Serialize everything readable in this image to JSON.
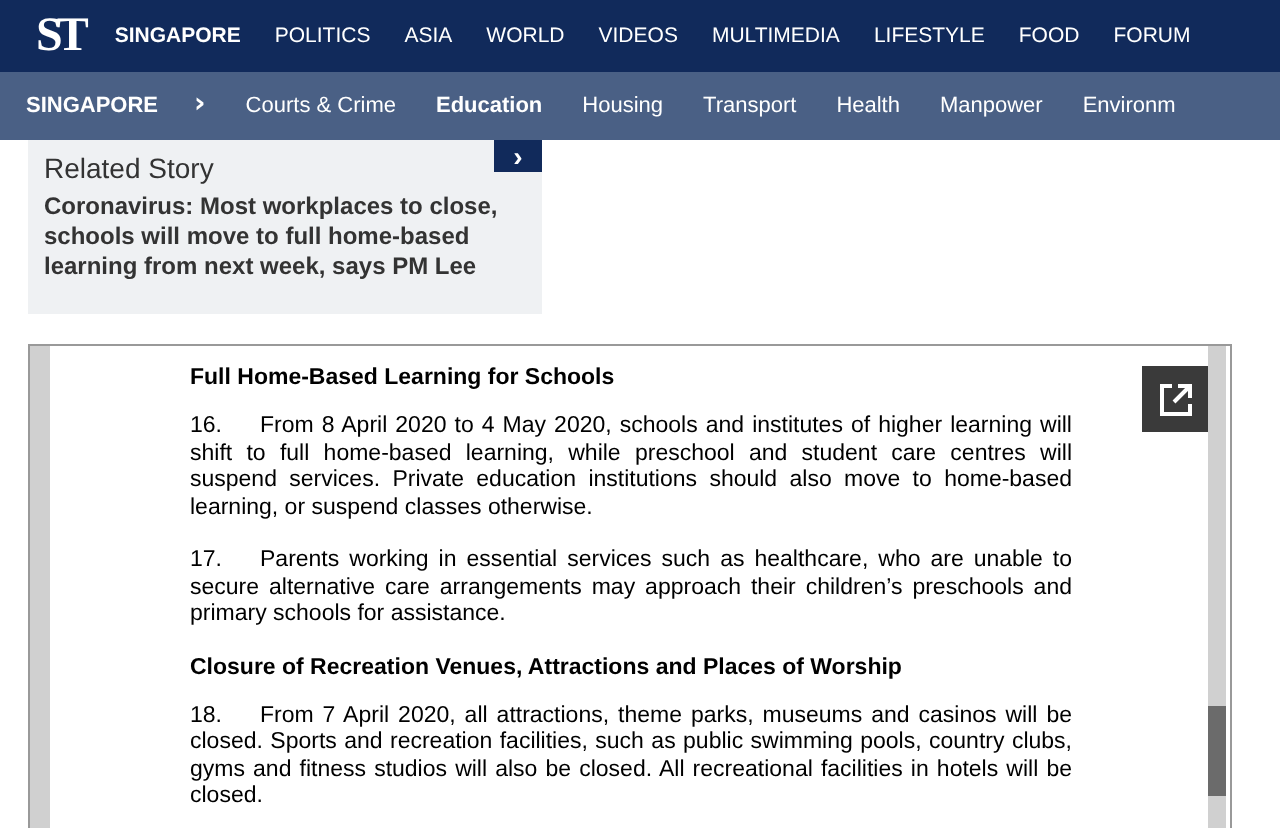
{
  "top_nav": {
    "logo": "ST",
    "items": [
      {
        "label": "SINGAPORE",
        "selected": true
      },
      {
        "label": "POLITICS",
        "selected": false
      },
      {
        "label": "ASIA",
        "selected": false
      },
      {
        "label": "WORLD",
        "selected": false
      },
      {
        "label": "VIDEOS",
        "selected": false
      },
      {
        "label": "MULTIMEDIA",
        "selected": false
      },
      {
        "label": "LIFESTYLE",
        "selected": false
      },
      {
        "label": "FOOD",
        "selected": false
      },
      {
        "label": "FORUM",
        "selected": false
      }
    ]
  },
  "sub_nav": {
    "section": "SINGAPORE",
    "separator": "›",
    "items": [
      {
        "label": "Courts & Crime",
        "selected": false
      },
      {
        "label": "Education",
        "selected": true
      },
      {
        "label": "Housing",
        "selected": false
      },
      {
        "label": "Transport",
        "selected": false
      },
      {
        "label": "Health",
        "selected": false
      },
      {
        "label": "Manpower",
        "selected": false
      },
      {
        "label": "Environm",
        "selected": false
      }
    ]
  },
  "related_story": {
    "label": "Related Story",
    "headline": "Coronavirus: Most workplaces to close, schools will move to full home-based learning from next week, says PM Lee",
    "arrow": "›"
  },
  "document": {
    "blocks": [
      {
        "kind": "heading",
        "text": "Full Home-Based Learning for Schools"
      },
      {
        "kind": "paragraph",
        "number": "16.",
        "text": "From 8 April 2020 to 4 May 2020, schools and institutes of higher learning will shift to full home-based learning, while preschool and student care centres will suspend services. Private education institutions should also move to home-based learning, or suspend classes otherwise."
      },
      {
        "kind": "paragraph",
        "number": "17.",
        "text": "Parents working in essential services such as healthcare, who are unable to secure alternative care arrangements may approach their children’s preschools and primary schools for assistance."
      },
      {
        "kind": "heading",
        "text": "Closure of Recreation Venues, Attractions and Places of Worship"
      },
      {
        "kind": "paragraph",
        "number": "18.",
        "text": "From 7 April 2020, all attractions, theme parks, museums and casinos will be closed. Sports and recreation facilities, such as public swimming pools, country clubs, gyms and fitness studios will also be closed. All recreational facilities in hotels will be closed."
      }
    ]
  }
}
